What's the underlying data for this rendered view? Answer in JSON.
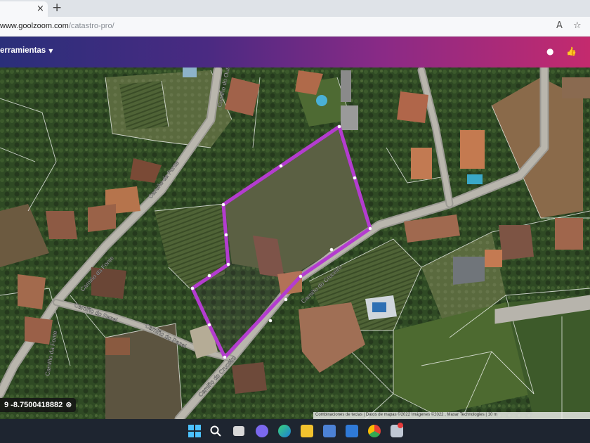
{
  "browser": {
    "tab_close": "×",
    "new_tab": "+",
    "url_host": "www.goolzoom.com",
    "url_path": "/catastro-pro/",
    "read_aloud_icon": "A",
    "favorites_icon": "☆"
  },
  "app": {
    "tools_menu": "erramientas",
    "tools_caret": "▼",
    "help_icon": "●",
    "like_icon": "👍"
  },
  "map": {
    "roads": {
      "camino_da_fonte": "Camiño da Fonte",
      "camino_da_fonte_upper": "Camiño da Fonte",
      "camino_do_pazal": "Camiño do Pazal",
      "camino_do_pazal_2": "Camiño do Pazal",
      "camino_do_cruceiro": "Camiño do Cruceiro",
      "camino_do_cruceiro_2": "Camiño do Cruceiro",
      "camino_do_outeiro": "Camiño do Outeiro",
      "camino_vertical_left": "Camiño da Fonte"
    },
    "parcel_color": "#b43ccf",
    "coordinates_text": "9 -8.7500418882",
    "close_icon": "⊗",
    "attribution": "Combinaciones de teclas  |  Datos de mapas ©2022 Imágenes ©2022 , Maxar Technologies  |  10 m"
  },
  "taskbar": {
    "icons": [
      "windows-start-icon",
      "search-icon",
      "task-view-icon",
      "chat-icon",
      "edge-icon",
      "file-explorer-icon",
      "store-icon",
      "mail-icon",
      "chrome-icon",
      "app-icon"
    ]
  }
}
